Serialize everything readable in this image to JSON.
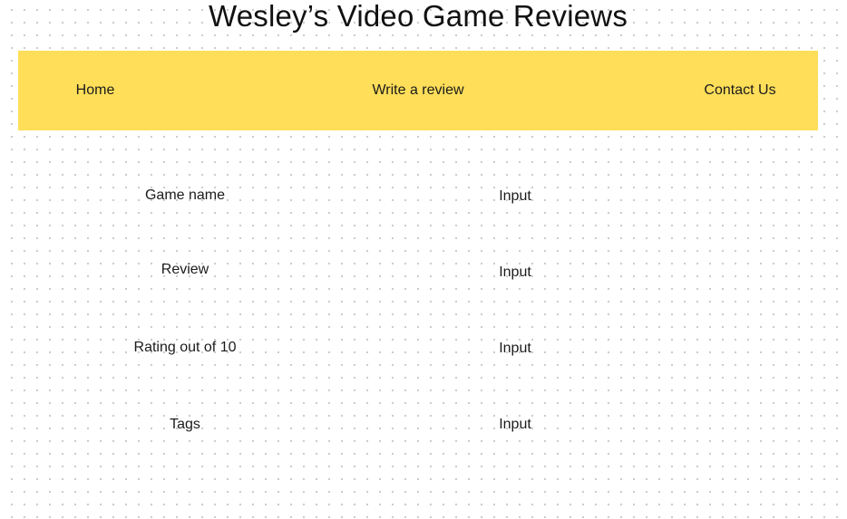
{
  "header": {
    "title": "Wesley’s Video Game Reviews"
  },
  "nav": {
    "items": [
      {
        "label": "Home"
      },
      {
        "label": "Write a review"
      },
      {
        "label": "Contact Us"
      }
    ]
  },
  "form": {
    "rows": [
      {
        "label": "Game name",
        "input_text": "Input"
      },
      {
        "label": "Review",
        "input_text": "Input"
      },
      {
        "label": "Rating out of 10",
        "input_text": "Input"
      },
      {
        "label": "Tags",
        "input_text": "Input"
      }
    ]
  },
  "colors": {
    "nav_background": "#ffde59",
    "page_background": "#ffffff",
    "dot_grid": "#c9c9c9",
    "text": "#1b1b1b"
  }
}
